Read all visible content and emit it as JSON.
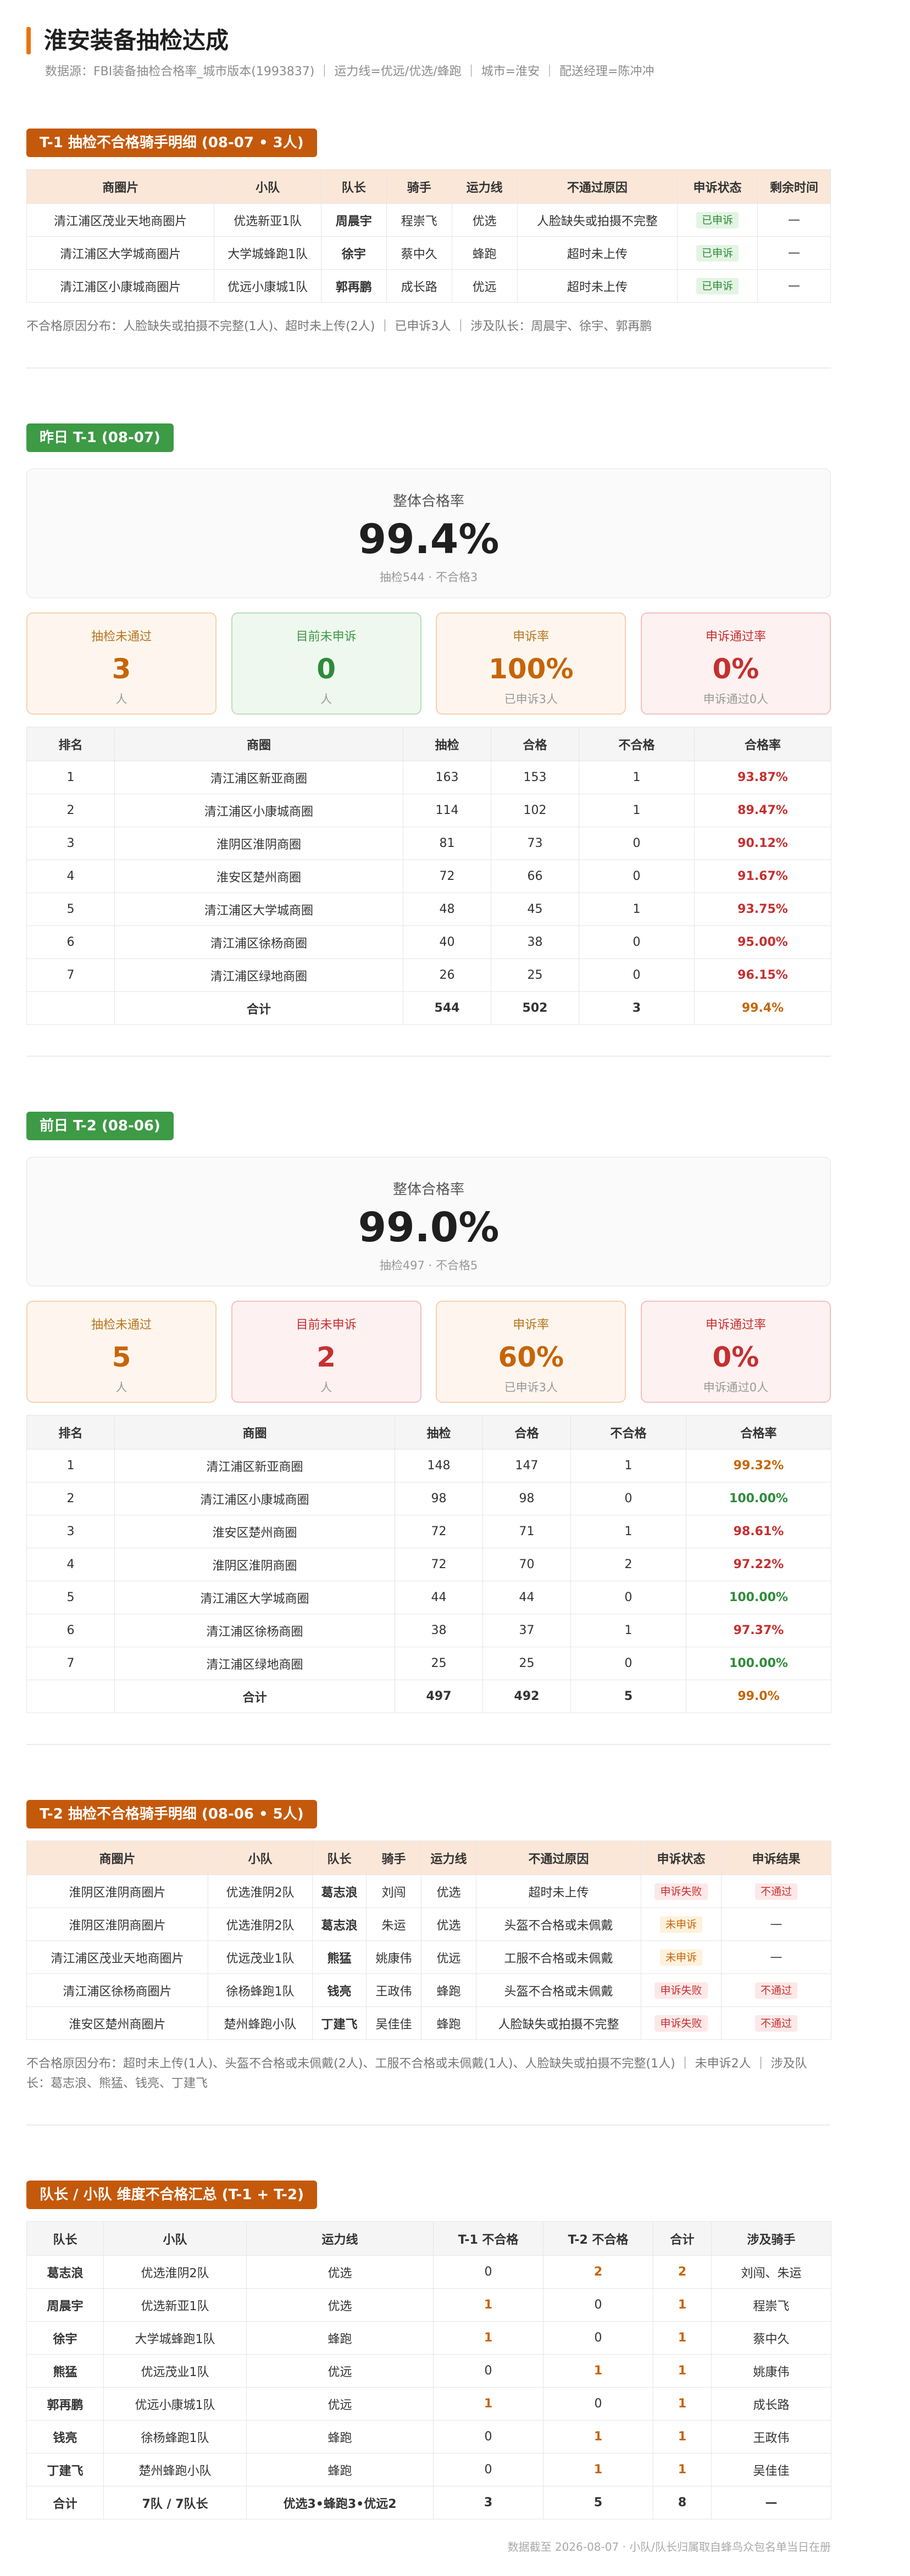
{
  "header": {
    "title": "淮安装备抽检达成",
    "subtitle": "数据源：FBI装备抽检合格率_城市版本(1993837) ｜ 运力线=优远/优选/蜂跑 ｜ 城市=淮安 ｜ 配送经理=陈冲冲"
  },
  "t1_detail": {
    "title": "T-1 抽检不合格骑手明细 (08-07 • 3人)",
    "columns": [
      "商圈片",
      "小队",
      "队长",
      "骑手",
      "运力线",
      "不通过原因",
      "申诉状态",
      "剩余时间"
    ],
    "rows": [
      {
        "area": "清江浦区茂业天地商圈片",
        "team": "优选新亚1队",
        "leader": "周晨宇",
        "rider": "程崇飞",
        "line": "优选",
        "reason": "人脸缺失或拍摄不完整",
        "status": "已申诉",
        "remain": "—"
      },
      {
        "area": "清江浦区大学城商圈片",
        "team": "大学城蜂跑1队",
        "leader": "徐宇",
        "rider": "蔡中久",
        "line": "蜂跑",
        "reason": "超时未上传",
        "status": "已申诉",
        "remain": "—"
      },
      {
        "area": "清江浦区小康城商圈片",
        "team": "优远小康城1队",
        "leader": "郭再鹏",
        "rider": "成长路",
        "line": "优远",
        "reason": "超时未上传",
        "status": "已申诉",
        "remain": "—"
      }
    ],
    "note": "不合格原因分布：人脸缺失或拍摄不完整(1人)、超时未上传(2人) ｜ 已申诉3人 ｜ 涉及队长：周晨宇、徐宇、郭再鹏"
  },
  "t1_summary": {
    "title": "昨日 T-1 (08-07)",
    "overall": {
      "label": "整体合格率",
      "value": "99.4%",
      "sub": "抽检544 · 不合格3"
    },
    "cards": [
      {
        "label": "抽检未通过",
        "value": "3",
        "sub": "人",
        "tone": "orange"
      },
      {
        "label": "目前未申诉",
        "value": "0",
        "sub": "人",
        "tone": "green"
      },
      {
        "label": "申诉率",
        "value": "100%",
        "sub": "已申诉3人",
        "tone": "orange"
      },
      {
        "label": "申诉通过率",
        "value": "0%",
        "sub": "申诉通过0人",
        "tone": "red"
      }
    ],
    "columns": [
      "排名",
      "商圈",
      "抽检",
      "合格",
      "不合格",
      "合格率"
    ],
    "rows": [
      {
        "rank": "1",
        "area": "清江浦区新亚商圈",
        "checked": "163",
        "passed": "153",
        "failed": "1",
        "rate": "93.87%",
        "tone": "red"
      },
      {
        "rank": "2",
        "area": "清江浦区小康城商圈",
        "checked": "114",
        "passed": "102",
        "failed": "1",
        "rate": "89.47%",
        "tone": "red"
      },
      {
        "rank": "3",
        "area": "淮阴区淮阴商圈",
        "checked": "81",
        "passed": "73",
        "failed": "0",
        "rate": "90.12%",
        "tone": "red"
      },
      {
        "rank": "4",
        "area": "淮安区楚州商圈",
        "checked": "72",
        "passed": "66",
        "failed": "0",
        "rate": "91.67%",
        "tone": "red"
      },
      {
        "rank": "5",
        "area": "清江浦区大学城商圈",
        "checked": "48",
        "passed": "45",
        "failed": "1",
        "rate": "93.75%",
        "tone": "red"
      },
      {
        "rank": "6",
        "area": "清江浦区徐杨商圈",
        "checked": "40",
        "passed": "38",
        "failed": "0",
        "rate": "95.00%",
        "tone": "red"
      },
      {
        "rank": "7",
        "area": "清江浦区绿地商圈",
        "checked": "26",
        "passed": "25",
        "failed": "0",
        "rate": "96.15%",
        "tone": "red"
      }
    ],
    "total": {
      "label": "合计",
      "checked": "544",
      "passed": "502",
      "failed": "3",
      "rate": "99.4%"
    }
  },
  "t2_summary": {
    "title": "前日 T-2 (08-06)",
    "overall": {
      "label": "整体合格率",
      "value": "99.0%",
      "sub": "抽检497 · 不合格5"
    },
    "cards": [
      {
        "label": "抽检未通过",
        "value": "5",
        "sub": "人",
        "tone": "orange"
      },
      {
        "label": "目前未申诉",
        "value": "2",
        "sub": "人",
        "tone": "red"
      },
      {
        "label": "申诉率",
        "value": "60%",
        "sub": "已申诉3人",
        "tone": "orange"
      },
      {
        "label": "申诉通过率",
        "value": "0%",
        "sub": "申诉通过0人",
        "tone": "red"
      }
    ],
    "columns": [
      "排名",
      "商圈",
      "抽检",
      "合格",
      "不合格",
      "合格率"
    ],
    "rows": [
      {
        "rank": "1",
        "area": "清江浦区新亚商圈",
        "checked": "148",
        "passed": "147",
        "failed": "1",
        "rate": "99.32%",
        "tone": "orange"
      },
      {
        "rank": "2",
        "area": "清江浦区小康城商圈",
        "checked": "98",
        "passed": "98",
        "failed": "0",
        "rate": "100.00%",
        "tone": "green"
      },
      {
        "rank": "3",
        "area": "淮安区楚州商圈",
        "checked": "72",
        "passed": "71",
        "failed": "1",
        "rate": "98.61%",
        "tone": "red"
      },
      {
        "rank": "4",
        "area": "淮阴区淮阴商圈",
        "checked": "72",
        "passed": "70",
        "failed": "2",
        "rate": "97.22%",
        "tone": "red"
      },
      {
        "rank": "5",
        "area": "清江浦区大学城商圈",
        "checked": "44",
        "passed": "44",
        "failed": "0",
        "rate": "100.00%",
        "tone": "green"
      },
      {
        "rank": "6",
        "area": "清江浦区徐杨商圈",
        "checked": "38",
        "passed": "37",
        "failed": "1",
        "rate": "97.37%",
        "tone": "red"
      },
      {
        "rank": "7",
        "area": "清江浦区绿地商圈",
        "checked": "25",
        "passed": "25",
        "failed": "0",
        "rate": "100.00%",
        "tone": "green"
      }
    ],
    "total": {
      "label": "合计",
      "checked": "497",
      "passed": "492",
      "failed": "5",
      "rate": "99.0%"
    }
  },
  "t2_detail": {
    "title": "T-2 抽检不合格骑手明细 (08-06 • 5人)",
    "columns": [
      "商圈片",
      "小队",
      "队长",
      "骑手",
      "运力线",
      "不通过原因",
      "申诉状态",
      "申诉结果"
    ],
    "rows": [
      {
        "area": "淮阴区淮阴商圈片",
        "team": "优选淮阴2队",
        "leader": "葛志浪",
        "rider": "刘闯",
        "line": "优选",
        "reason": "超时未上传",
        "status": "申诉失败",
        "status_tone": "red",
        "result": "不通过"
      },
      {
        "area": "淮阴区淮阴商圈片",
        "team": "优选淮阴2队",
        "leader": "葛志浪",
        "rider": "朱运",
        "line": "优选",
        "reason": "头盔不合格或未佩戴",
        "status": "未申诉",
        "status_tone": "amber",
        "result": "—"
      },
      {
        "area": "清江浦区茂业天地商圈片",
        "team": "优远茂业1队",
        "leader": "熊猛",
        "rider": "姚康伟",
        "line": "优远",
        "reason": "工服不合格或未佩戴",
        "status": "未申诉",
        "status_tone": "amber",
        "result": "—"
      },
      {
        "area": "清江浦区徐杨商圈片",
        "team": "徐杨蜂跑1队",
        "leader": "钱亮",
        "rider": "王政伟",
        "line": "蜂跑",
        "reason": "头盔不合格或未佩戴",
        "status": "申诉失败",
        "status_tone": "red",
        "result": "不通过"
      },
      {
        "area": "淮安区楚州商圈片",
        "team": "楚州蜂跑小队",
        "leader": "丁建飞",
        "rider": "吴佳佳",
        "line": "蜂跑",
        "reason": "人脸缺失或拍摄不完整",
        "status": "申诉失败",
        "status_tone": "red",
        "result": "不通过"
      }
    ],
    "note": "不合格原因分布：超时未上传(1人)、头盔不合格或未佩戴(2人)、工服不合格或未佩戴(1人)、人脸缺失或拍摄不完整(1人) ｜ 未申诉2人 ｜ 涉及队长：葛志浪、熊猛、钱亮、丁建飞"
  },
  "leader_summary": {
    "title": "队长 / 小队 维度不合格汇总 (T-1 + T-2)",
    "columns": [
      "队长",
      "小队",
      "运力线",
      "T-1 不合格",
      "T-2 不合格",
      "合计",
      "涉及骑手"
    ],
    "rows": [
      {
        "leader": "葛志浪",
        "team": "优选淮阴2队",
        "line": "优选",
        "t1": "0",
        "t2": "2",
        "sum": "2",
        "riders": "刘闯、朱运"
      },
      {
        "leader": "周晨宇",
        "team": "优选新亚1队",
        "line": "优选",
        "t1": "1",
        "t2": "0",
        "sum": "1",
        "riders": "程崇飞"
      },
      {
        "leader": "徐宇",
        "team": "大学城蜂跑1队",
        "line": "蜂跑",
        "t1": "1",
        "t2": "0",
        "sum": "1",
        "riders": "蔡中久"
      },
      {
        "leader": "熊猛",
        "team": "优远茂业1队",
        "line": "优远",
        "t1": "0",
        "t2": "1",
        "sum": "1",
        "riders": "姚康伟"
      },
      {
        "leader": "郭再鹏",
        "team": "优远小康城1队",
        "line": "优远",
        "t1": "1",
        "t2": "0",
        "sum": "1",
        "riders": "成长路"
      },
      {
        "leader": "钱亮",
        "team": "徐杨蜂跑1队",
        "line": "蜂跑",
        "t1": "0",
        "t2": "1",
        "sum": "1",
        "riders": "王政伟"
      },
      {
        "leader": "丁建飞",
        "team": "楚州蜂跑小队",
        "line": "蜂跑",
        "t1": "0",
        "t2": "1",
        "sum": "1",
        "riders": "吴佳佳"
      }
    ],
    "total": {
      "leader": "合计",
      "team": "7队 / 7队长",
      "line": "优选3•蜂跑3•优远2",
      "t1": "3",
      "t2": "5",
      "sum": "8",
      "riders": "—"
    }
  },
  "footer": "数据截至 2026-08-07 · 小队/队长归属取自蜂鸟众包名单当日在册",
  "colors": {
    "accent": "#c4590b",
    "green": "#3d9a45",
    "red": "#c53030"
  }
}
